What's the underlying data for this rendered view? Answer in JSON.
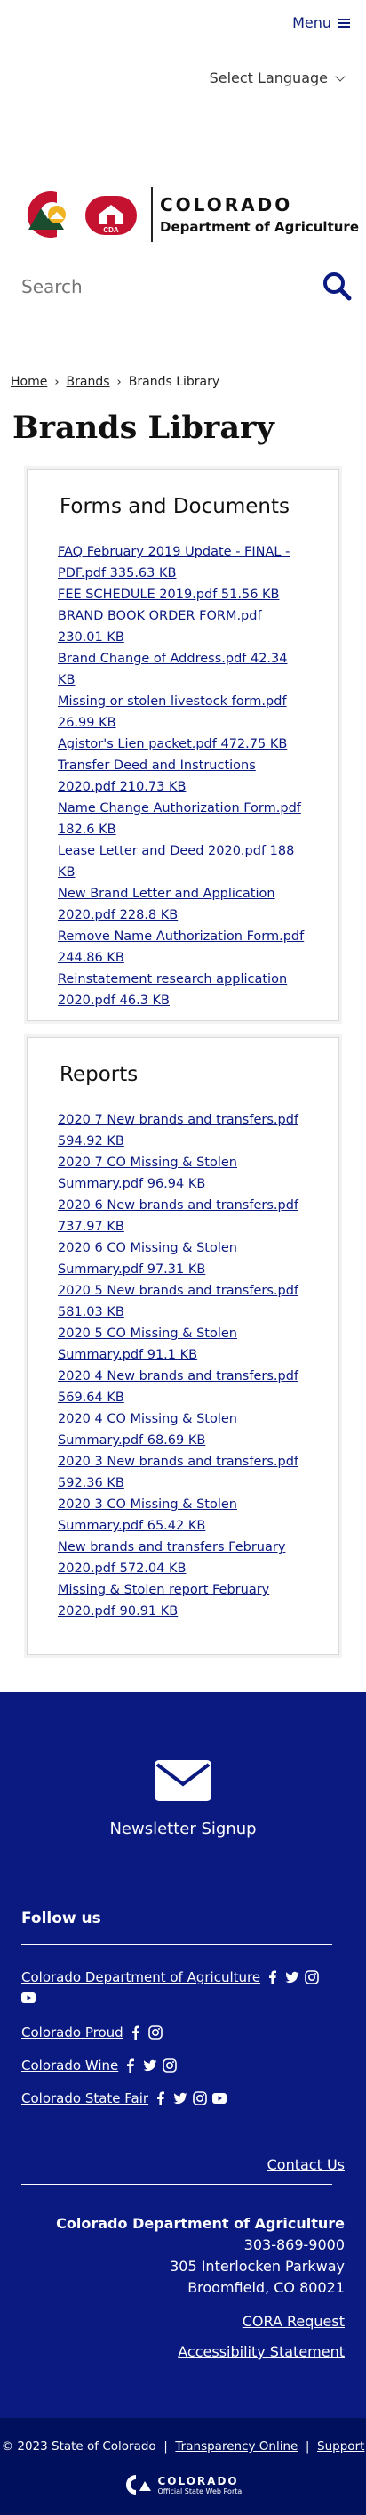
{
  "header": {
    "menu_label": "Menu",
    "language_label": "Select Language",
    "logo": {
      "state": "COLORADO",
      "department": "Department of Agriculture",
      "badge": "CDA"
    },
    "search_placeholder": "Search"
  },
  "breadcrumb": {
    "home": "Home",
    "brands": "Brands",
    "current": "Brands Library"
  },
  "page_title": "Brands Library",
  "forms": {
    "title": "Forms and Documents",
    "items": [
      "FAQ February 2019 Update - FINAL - PDF.pdf 335.63 KB",
      "FEE SCHEDULE 2019.pdf 51.56 KB",
      "BRAND BOOK ORDER FORM.pdf 230.01 KB",
      "Brand Change of Address.pdf 42.34 KB",
      "Missing or stolen livestock form.pdf 26.99 KB",
      "Agistor's Lien packet.pdf 472.75 KB",
      "Transfer Deed and Instructions 2020.pdf 210.73 KB",
      "Name Change Authorization Form.pdf 182.6 KB",
      "Lease Letter and Deed 2020.pdf 188 KB",
      "New Brand Letter and Application 2020.pdf 228.8 KB",
      "Remove Name Authorization Form.pdf 244.86 KB",
      "Reinstatement research application 2020.pdf 46.3 KB"
    ]
  },
  "reports": {
    "title": "Reports",
    "items": [
      "2020 7 New brands and transfers.pdf 594.92 KB",
      "2020 7 CO Missing & Stolen Summary.pdf 96.94 KB",
      "2020 6 New brands and transfers.pdf 737.97 KB",
      "2020 6 CO Missing & Stolen Summary.pdf 97.31 KB",
      "2020 5 New brands and transfers.pdf 581.03 KB",
      "2020 5 CO Missing & Stolen Summary.pdf 91.1 KB",
      "2020 4 New brands and transfers.pdf 569.64 KB",
      "2020 4 CO Missing & Stolen Summary.pdf 68.69 KB",
      "2020 3 New brands and transfers.pdf 592.36 KB",
      "2020 3 CO Missing & Stolen Summary.pdf 65.42 KB",
      "New brands and transfers February 2020.pdf 572.04 KB",
      "Missing & Stolen report February 2020.pdf 90.91 KB"
    ]
  },
  "footer": {
    "newsletter": "Newsletter Signup",
    "follow": "Follow us",
    "social": [
      {
        "name": "Colorado Department of Agriculture",
        "icons": [
          "facebook-icon",
          "twitter-icon",
          "instagram-icon",
          "youtube-icon"
        ]
      },
      {
        "name": "Colorado Proud",
        "icons": [
          "facebook-icon",
          "instagram-icon"
        ]
      },
      {
        "name": "Colorado Wine",
        "icons": [
          "facebook-icon",
          "twitter-icon",
          "instagram-icon"
        ]
      },
      {
        "name": "Colorado State Fair",
        "icons": [
          "facebook-icon",
          "twitter-icon",
          "instagram-icon",
          "youtube-icon"
        ]
      }
    ],
    "contact": "Contact Us",
    "org": "Colorado Department of Agriculture",
    "phone": "303-869-9000",
    "street": "305 Interlocken Parkway",
    "city": "Broomfield, CO 80021",
    "cora": "CORA Request",
    "accessibility": "Accessibility Statement"
  },
  "bottom": {
    "copyright": "© 2023 State of Colorado",
    "transparency": "Transparency Online",
    "support": "Support",
    "portal_name": "COLORADO",
    "portal_sub": "Official State Web Portal"
  },
  "colors": {
    "footer_bg": "#0a1a80",
    "bottom_bg": "#00105d",
    "link": "#0a1a80"
  }
}
